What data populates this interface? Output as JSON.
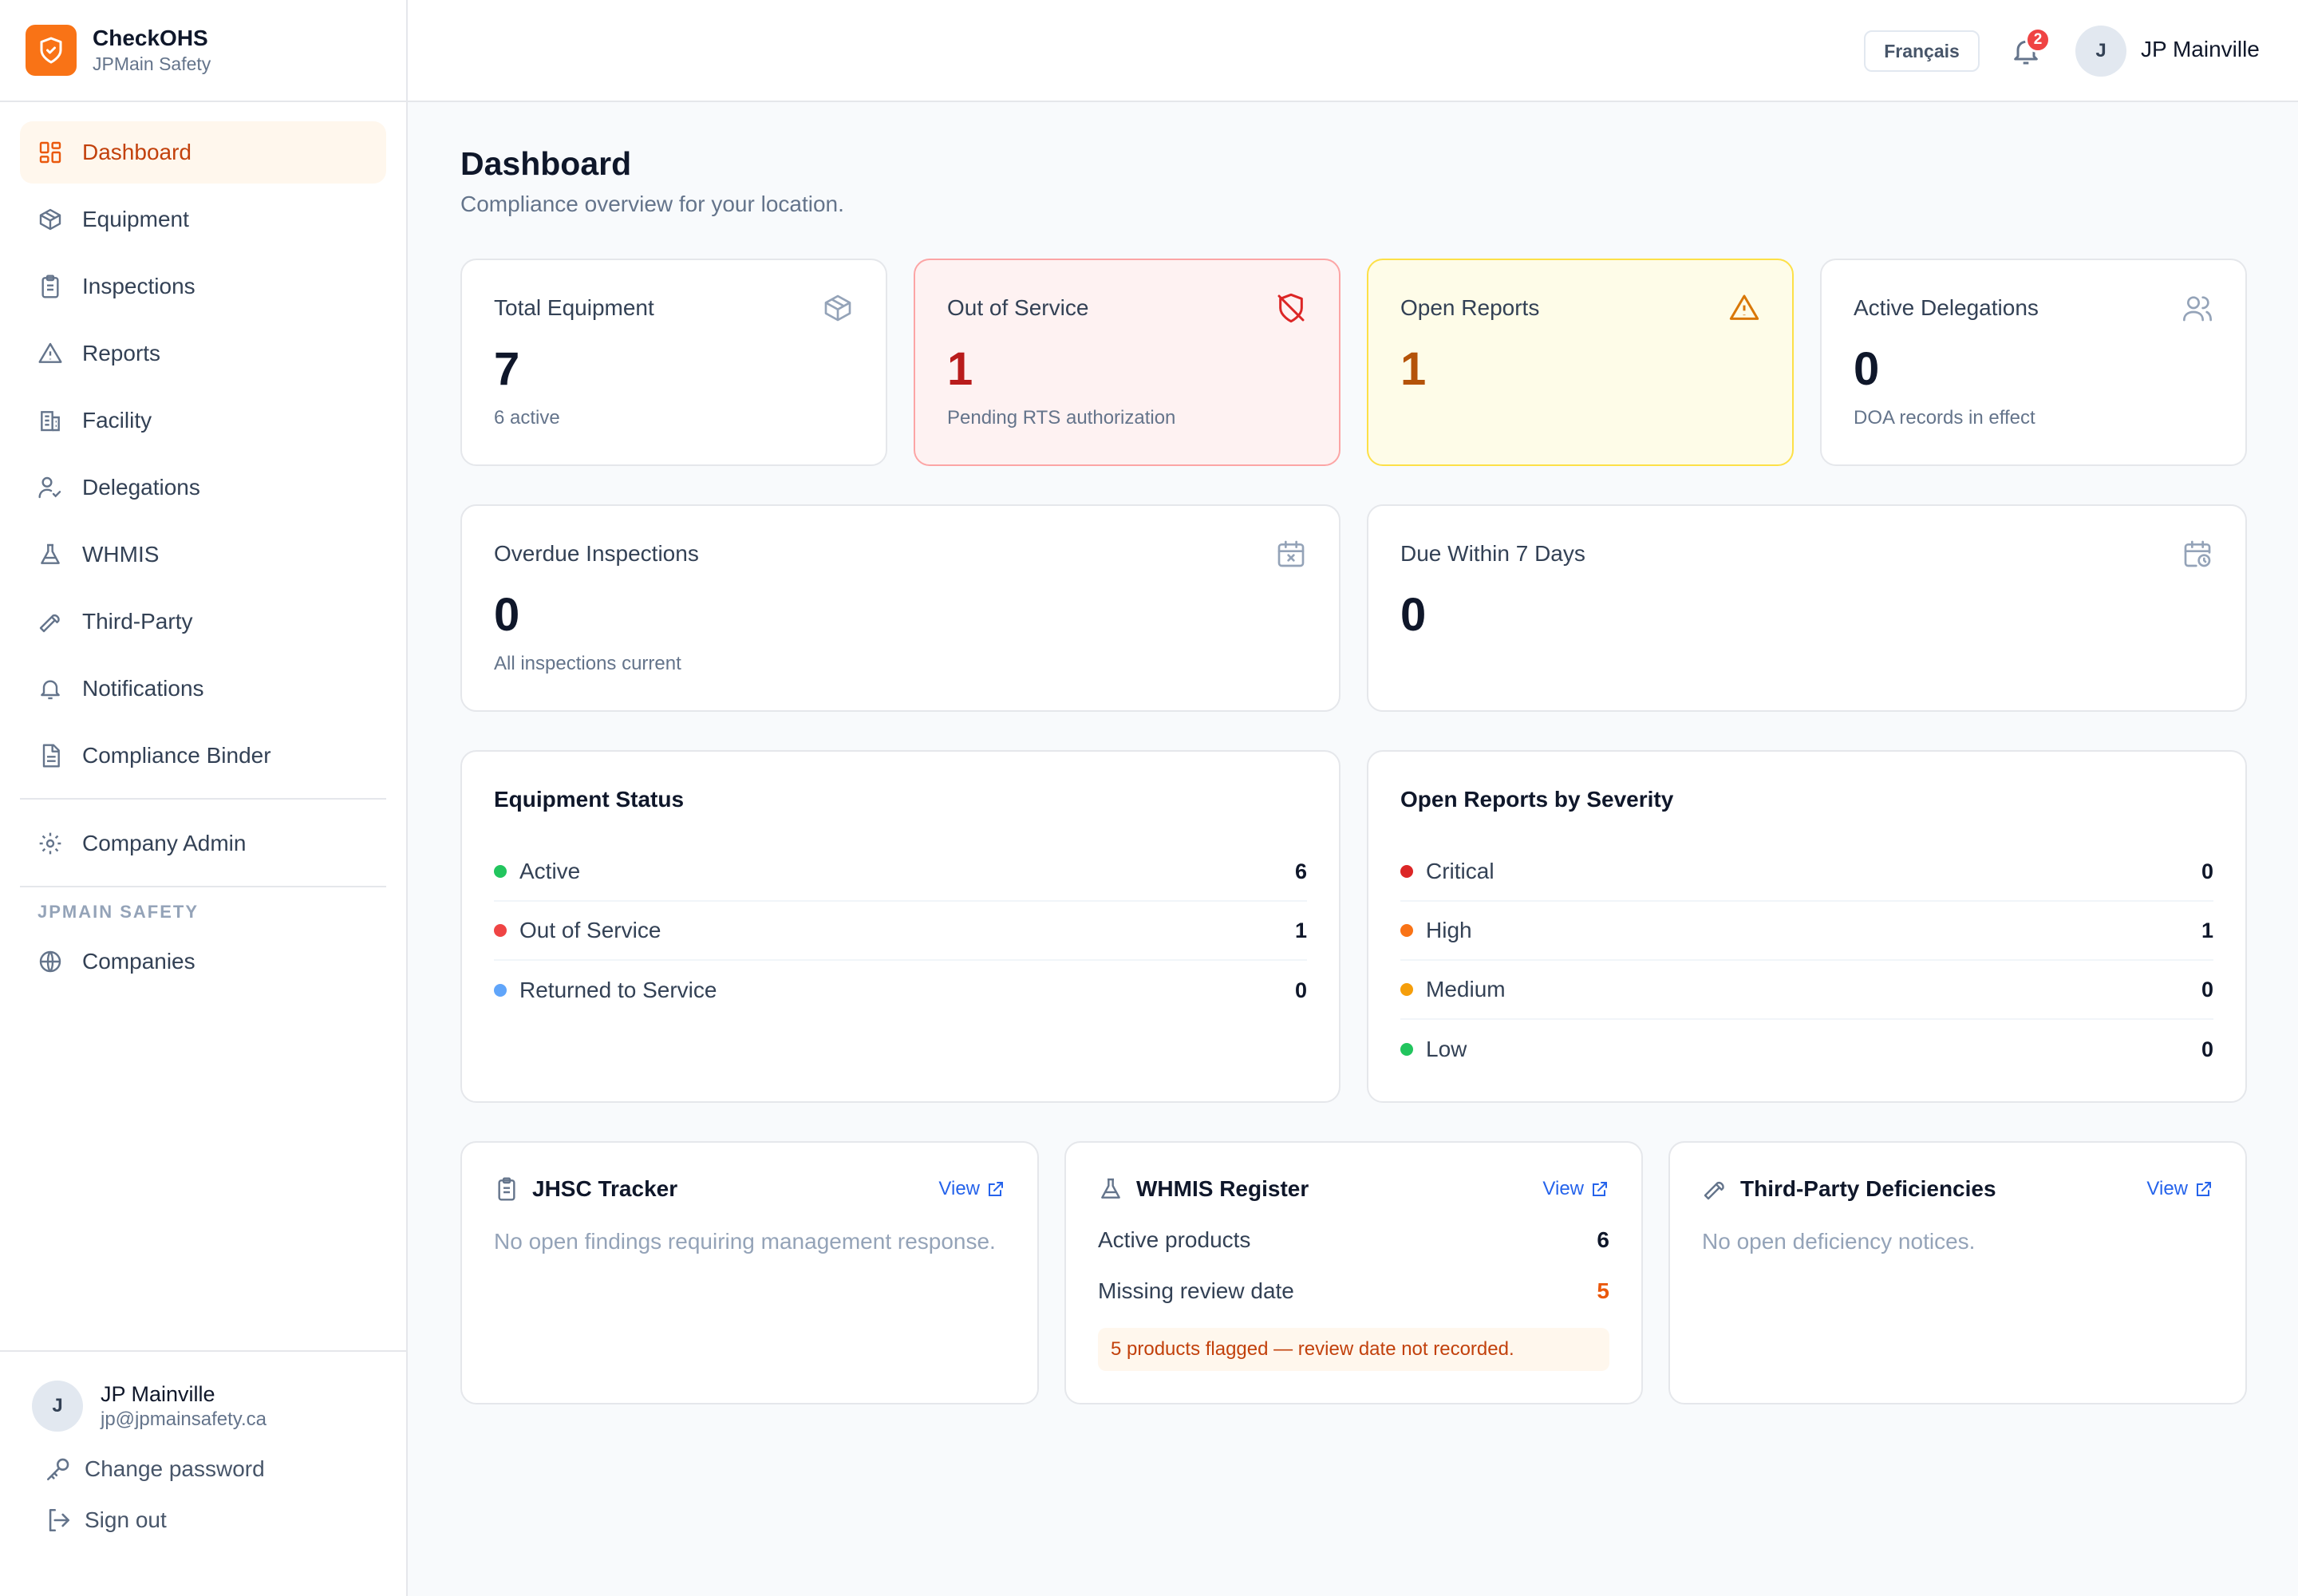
{
  "brand": {
    "name": "CheckOHS",
    "org": "JPMain Safety",
    "accent": "#f97316"
  },
  "sidebar": {
    "items": [
      {
        "label": "Dashboard",
        "icon": "dashboard-icon",
        "active": true
      },
      {
        "label": "Equipment",
        "icon": "cube-icon"
      },
      {
        "label": "Inspections",
        "icon": "clipboard-icon"
      },
      {
        "label": "Reports",
        "icon": "warning-triangle-icon"
      },
      {
        "label": "Facility",
        "icon": "building-icon"
      },
      {
        "label": "Delegations",
        "icon": "user-check-icon"
      },
      {
        "label": "WHMIS",
        "icon": "flask-icon"
      },
      {
        "label": "Third-Party",
        "icon": "wrench-icon"
      },
      {
        "label": "Notifications",
        "icon": "bell-icon"
      },
      {
        "label": "Compliance Binder",
        "icon": "document-icon"
      }
    ],
    "admin_item": {
      "label": "Company Admin",
      "icon": "gear-icon"
    },
    "section_heading": "JPMAIN SAFETY",
    "section_item": {
      "label": "Companies",
      "icon": "globe-icon"
    }
  },
  "footer": {
    "avatar_initial": "J",
    "user_name": "JP Mainville",
    "user_email": "jp@jpmainsafety.ca",
    "change_password": "Change password",
    "sign_out": "Sign out"
  },
  "topbar": {
    "language_button": "Français",
    "notification_count": "2",
    "avatar_initial": "J",
    "user_name": "JP Mainville"
  },
  "page": {
    "title": "Dashboard",
    "subtitle": "Compliance overview for your location."
  },
  "stats": {
    "total_equipment": {
      "label": "Total Equipment",
      "value": "7",
      "note": "6 active"
    },
    "out_of_service": {
      "label": "Out of Service",
      "value": "1",
      "note": "Pending RTS authorization"
    },
    "open_reports": {
      "label": "Open Reports",
      "value": "1"
    },
    "active_delegations": {
      "label": "Active Delegations",
      "value": "0",
      "note": "DOA records in effect"
    },
    "overdue_inspections": {
      "label": "Overdue Inspections",
      "value": "0",
      "note": "All inspections current"
    },
    "due_within_7_days": {
      "label": "Due Within 7 Days",
      "value": "0"
    }
  },
  "equipment_status": {
    "title": "Equipment Status",
    "rows": [
      {
        "label": "Active",
        "value": "6",
        "color": "#22c55e"
      },
      {
        "label": "Out of Service",
        "value": "1",
        "color": "#ef4444"
      },
      {
        "label": "Returned to Service",
        "value": "0",
        "color": "#60a5fa"
      }
    ]
  },
  "reports_by_severity": {
    "title": "Open Reports by Severity",
    "rows": [
      {
        "label": "Critical",
        "value": "0",
        "color": "#dc2626"
      },
      {
        "label": "High",
        "value": "1",
        "color": "#f97316"
      },
      {
        "label": "Medium",
        "value": "0",
        "color": "#f59e0b"
      },
      {
        "label": "Low",
        "value": "0",
        "color": "#22c55e"
      }
    ]
  },
  "jhsc": {
    "title": "JHSC Tracker",
    "view": "View",
    "empty": "No open findings requiring management response."
  },
  "whmis": {
    "title": "WHMIS Register",
    "view": "View",
    "active_label": "Active products",
    "active_value": "6",
    "missing_label": "Missing review date",
    "missing_value": "5",
    "flag": "5 products flagged — review date not recorded."
  },
  "third_party": {
    "title": "Third-Party Deficiencies",
    "view": "View",
    "empty": "No open deficiency notices."
  }
}
